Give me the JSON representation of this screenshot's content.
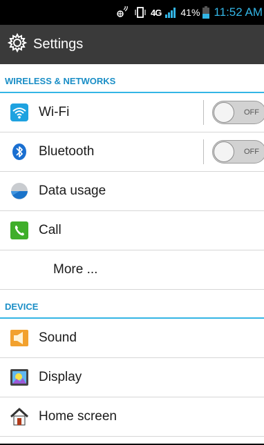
{
  "status_bar": {
    "network": "4G",
    "battery_percent": "41%",
    "battery_level": 0.41,
    "time": "11:52 AM",
    "signal_bars": 4
  },
  "action_bar": {
    "icon": "gear-icon",
    "title": "Settings"
  },
  "sections": [
    {
      "header": "WIRELESS & NETWORKS",
      "items": [
        {
          "label": "Wi-Fi",
          "icon": "wifi-icon",
          "toggle": "OFF"
        },
        {
          "label": "Bluetooth",
          "icon": "bluetooth-icon",
          "toggle": "OFF"
        },
        {
          "label": "Data usage",
          "icon": "data-usage-icon"
        },
        {
          "label": "Call",
          "icon": "phone-icon"
        },
        {
          "label": "More ..."
        }
      ]
    },
    {
      "header": "DEVICE",
      "items": [
        {
          "label": "Sound",
          "icon": "speaker-icon"
        },
        {
          "label": "Display",
          "icon": "display-icon"
        },
        {
          "label": "Home screen",
          "icon": "home-icon"
        }
      ]
    }
  ],
  "colors": {
    "accent": "#33b5e5",
    "header_text": "#1a8ec6",
    "action_bar": "#3a3a3a"
  }
}
